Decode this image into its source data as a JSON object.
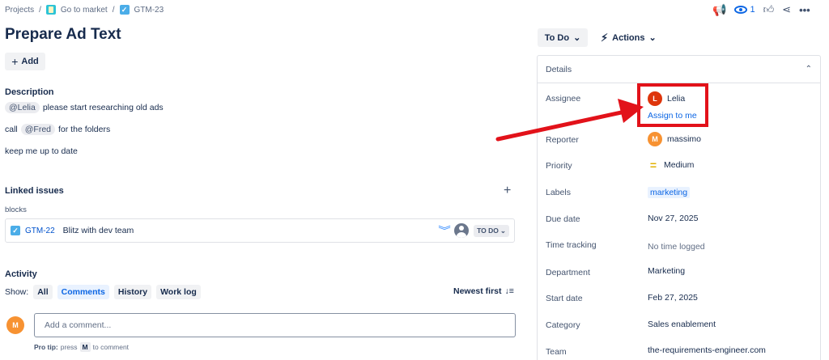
{
  "breadcrumb": {
    "projects": "Projects",
    "sep": "/",
    "project": "Go to market",
    "issue_key": "GTM-23"
  },
  "issue": {
    "title": "Prepare Ad Text",
    "add_label": "Add"
  },
  "description": {
    "heading": "Description",
    "line1_mention": "@Lelia",
    "line1_text": "please start researching old ads",
    "line2_prefix": "call",
    "line2_mention": "@Fred",
    "line2_text": "for the folders",
    "line3": "keep me up to date"
  },
  "linked": {
    "heading": "Linked issues",
    "relation": "blocks",
    "item": {
      "key": "GTM-22",
      "summary": "Blitz with dev team",
      "status": "TO DO"
    }
  },
  "activity": {
    "heading": "Activity",
    "show_label": "Show:",
    "tabs": [
      "All",
      "Comments",
      "History",
      "Work log"
    ],
    "active_tab": "Comments",
    "sort": "Newest first",
    "avatar_initial": "M",
    "comment_placeholder": "Add a comment...",
    "protip_bold": "Pro tip:",
    "protip_press": "press",
    "protip_key": "M",
    "protip_rest": "to comment"
  },
  "header_right": {
    "watch_count": "1"
  },
  "status_button": "To Do",
  "actions_button": "Actions",
  "details": {
    "heading": "Details",
    "assignee_label": "Assignee",
    "assignee_initial": "L",
    "assignee_name": "Lelia",
    "assign_to_me": "Assign to me",
    "reporter_label": "Reporter",
    "reporter_initial": "M",
    "reporter_name": "massimo",
    "priority_label": "Priority",
    "priority_value": "Medium",
    "labels_label": "Labels",
    "labels_value": "marketing",
    "due_label": "Due date",
    "due_value": "Nov 27, 2025",
    "time_label": "Time tracking",
    "time_value": "No time logged",
    "dept_label": "Department",
    "dept_value": "Marketing",
    "start_label": "Start date",
    "start_value": "Feb 27, 2025",
    "category_label": "Category",
    "category_value": "Sales enablement",
    "team_label": "Team",
    "team_value": "the-requirements-engineer.com"
  },
  "colors": {
    "annotation_red": "#e2121a",
    "assignee_avatar": "#de350b",
    "reporter_avatar": "#f79232",
    "link_blue": "#0c66e4"
  }
}
